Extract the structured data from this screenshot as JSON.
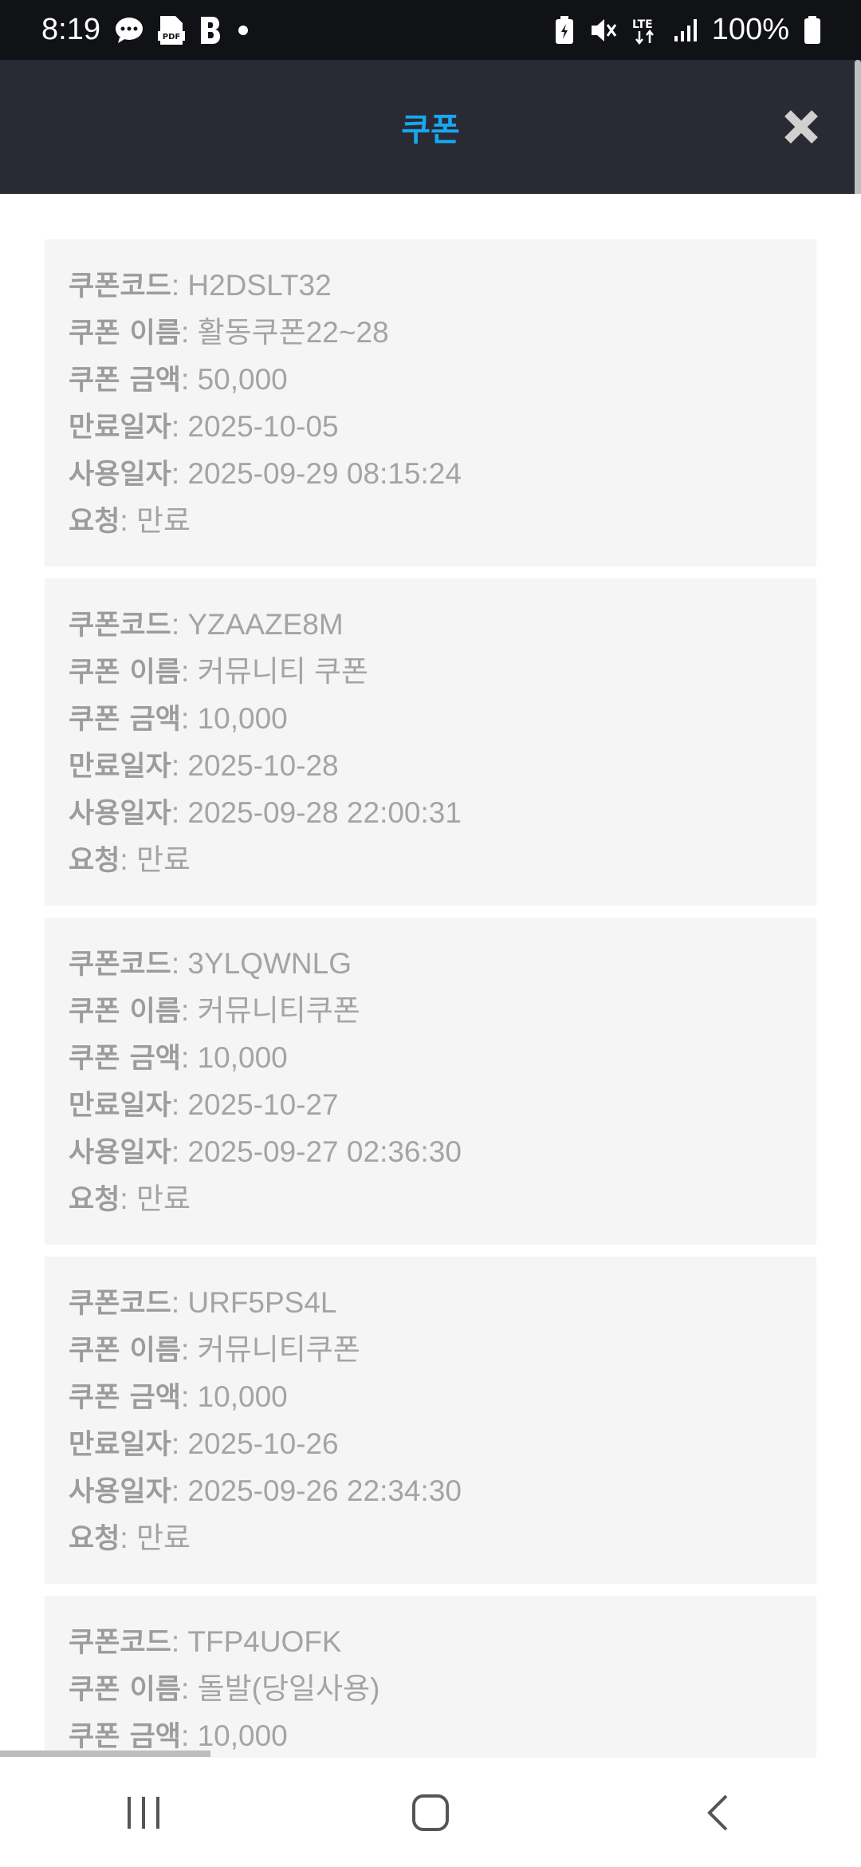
{
  "status_bar": {
    "time": "8:19",
    "battery": "100%",
    "network": "LTE"
  },
  "header": {
    "title": "쿠폰"
  },
  "labels": {
    "code": "쿠폰코드",
    "name": "쿠폰 이름",
    "amount": "쿠폰 금액",
    "expiry": "만료일자",
    "used": "사용일자",
    "request": "요청"
  },
  "coupons": [
    {
      "code": "H2DSLT32",
      "name": "활동쿠폰22~28",
      "amount": "50,000",
      "expiry": "2025-10-05",
      "used": "2025-09-29 08:15:24",
      "request": "만료"
    },
    {
      "code": "YZAAZE8M",
      "name": "커뮤니티 쿠폰",
      "amount": "10,000",
      "expiry": "2025-10-28",
      "used": "2025-09-28 22:00:31",
      "request": "만료"
    },
    {
      "code": "3YLQWNLG",
      "name": "커뮤니티쿠폰",
      "amount": "10,000",
      "expiry": "2025-10-27",
      "used": "2025-09-27 02:36:30",
      "request": "만료"
    },
    {
      "code": "URF5PS4L",
      "name": "커뮤니티쿠폰",
      "amount": "10,000",
      "expiry": "2025-10-26",
      "used": "2025-09-26 22:34:30",
      "request": "만료"
    },
    {
      "code": "TFP4UOFK",
      "name": "돌발(당일사용)",
      "amount": "10,000"
    }
  ]
}
